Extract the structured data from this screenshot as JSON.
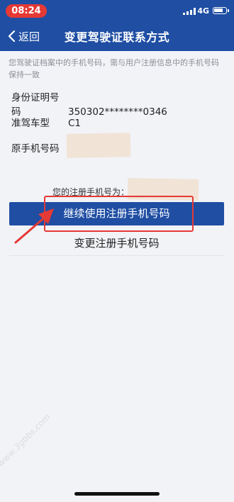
{
  "status": {
    "time": "08:24",
    "network": "4G"
  },
  "nav": {
    "back_label": "返回",
    "title": "变更驾驶证联系方式"
  },
  "notice": "您驾驶证档案中的手机号码，需与用户注册信息中的手机号码保持一致",
  "info": {
    "id_label": "身份证明号码",
    "id_value": "350302********0346",
    "class_label": "准驾车型",
    "class_value": "C1",
    "phone_label": "原手机号码"
  },
  "registered_label": "您的注册手机号为：",
  "buttons": {
    "continue": "继续使用注册手机号码",
    "change": "变更注册手机号码"
  },
  "watermark": "www.3gbbs.com",
  "colors": {
    "primary": "#1f4ea3",
    "highlight": "#e53935",
    "background": "#f2f3f7"
  }
}
